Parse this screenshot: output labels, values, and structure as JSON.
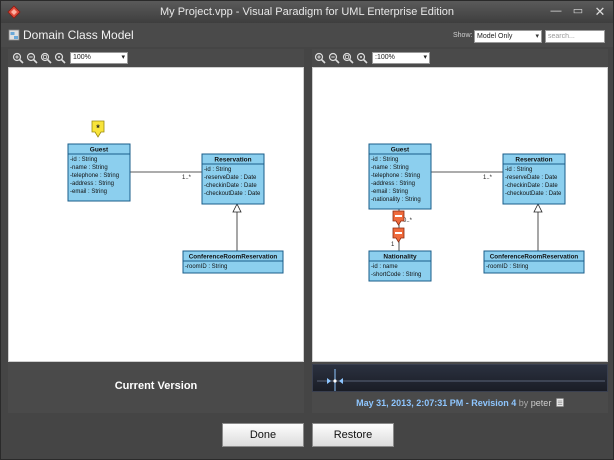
{
  "window": {
    "title": "My Project.vpp - Visual Paradigm for UML Enterprise Edition",
    "min_glyph": "—",
    "max_glyph": "▭",
    "close_glyph": "✕"
  },
  "header": {
    "title": "Domain Class Model",
    "show_label": "Show:",
    "show_value": "Model Only",
    "search_placeholder": "search..."
  },
  "zoom": {
    "left": "100%",
    "right": ":100%"
  },
  "left_diagram": {
    "classes": {
      "guest": {
        "name": "Guest",
        "attrs": [
          "-id : String",
          "-name : String",
          "-telephone : String",
          "-address : String",
          "-email : String"
        ]
      },
      "reservation": {
        "name": "Reservation",
        "attrs": [
          "-id : String",
          "-reserveDate : Date",
          "-checkinDate : Date",
          "-checkoutDate : Date"
        ]
      },
      "conference": {
        "name": "ConferenceRoomReservation",
        "attrs": [
          "-roomID : String"
        ]
      }
    },
    "mult_guest_res": "1..*"
  },
  "right_diagram": {
    "classes": {
      "guest": {
        "name": "Guest",
        "attrs": [
          "-id : String",
          "-name : String",
          "-telephone : String",
          "-address : String",
          "-email : String",
          "-nationality : String"
        ]
      },
      "reservation": {
        "name": "Reservation",
        "attrs": [
          "-id : String",
          "-reserveDate : Date",
          "-checkinDate : Date",
          "-checkoutDate : Date"
        ]
      },
      "nationality": {
        "name": "Nationality",
        "attrs": [
          "-id : name",
          "-shortCode : String"
        ]
      },
      "conference": {
        "name": "ConferenceRoomReservation",
        "attrs": [
          "-roomID : String"
        ]
      }
    },
    "mult_guest_res": "1..*",
    "mult_guest_nat_top": "0..*",
    "mult_guest_nat_bottom": "1"
  },
  "footer": {
    "current_label": "Current Version",
    "rev_date": "May 31, 2013, 2:07:31 PM - Revision 4",
    "rev_by": "by",
    "rev_user": "peter"
  },
  "buttons": {
    "done": "Done",
    "restore": "Restore"
  },
  "colors": {
    "class_fill": "#8ccfee",
    "class_header": "#7ec4e8",
    "class_stroke": "#1a5d8a",
    "marker_yellow": "#f8e43a",
    "marker_red": "#ef6a3c"
  },
  "icons": {
    "app": "visual-paradigm-icon",
    "header": "diagram-icon",
    "zoom": [
      "zoom-in-icon",
      "zoom-out-icon",
      "zoom-fit-icon",
      "zoom-actual-icon"
    ],
    "revision": "document-icon"
  }
}
